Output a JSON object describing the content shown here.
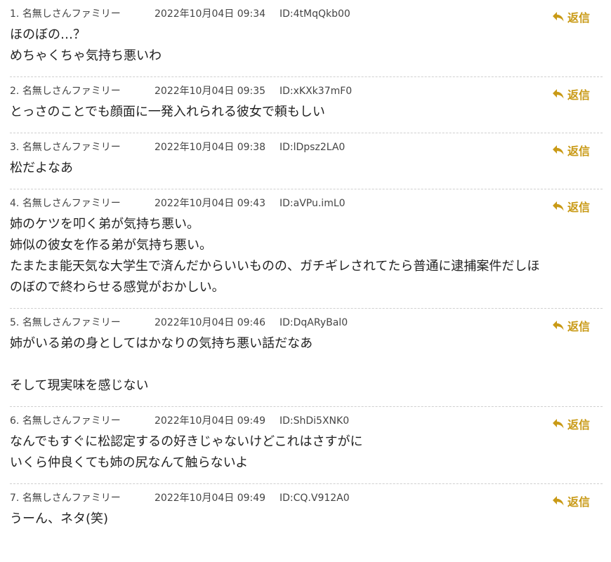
{
  "accent_color": "#c99a16",
  "reply_label": "返信",
  "comments": [
    {
      "num": "1.",
      "name": "名無しさんファミリー",
      "date": "2022年10月04日 09:34",
      "id": "ID:4tMqQkb00",
      "lines": [
        "ほのぼの…？",
        "めちゃくちゃ気持ち悪いわ"
      ]
    },
    {
      "num": "2.",
      "name": "名無しさんファミリー",
      "date": "2022年10月04日 09:35",
      "id": "ID:xKXk37mF0",
      "lines": [
        "とっさのことでも顔面に一発入れられる彼女で頼もしい"
      ]
    },
    {
      "num": "3.",
      "name": "名無しさんファミリー",
      "date": "2022年10月04日 09:38",
      "id": "ID:lDpsz2LA0",
      "lines": [
        "松だよなあ"
      ]
    },
    {
      "num": "4.",
      "name": "名無しさんファミリー",
      "date": "2022年10月04日 09:43",
      "id": "ID:aVPu.imL0",
      "lines": [
        "姉のケツを叩く弟が気持ち悪い。",
        "姉似の彼女を作る弟が気持ち悪い。",
        "たまたま能天気な大学生で済んだからいいものの、ガチギレされてたら普通に逮捕案件だしほ",
        "のぼので終わらせる感覚がおかしい。"
      ]
    },
    {
      "num": "5.",
      "name": "名無しさんファミリー",
      "date": "2022年10月04日 09:46",
      "id": "ID:DqARyBal0",
      "lines": [
        "姉がいる弟の身としてはかなりの気持ち悪い話だなあ",
        "",
        "そして現実味を感じない"
      ]
    },
    {
      "num": "6.",
      "name": "名無しさんファミリー",
      "date": "2022年10月04日 09:49",
      "id": "ID:ShDi5XNK0",
      "lines": [
        "なんでもすぐに松認定するの好きじゃないけどこれはさすがに",
        "いくら仲良くても姉の尻なんて触らないよ"
      ]
    },
    {
      "num": "7.",
      "name": "名無しさんファミリー",
      "date": "2022年10月04日 09:49",
      "id": "ID:CQ.V912A0",
      "lines": [
        "うーん、ネタ(笑)"
      ]
    }
  ]
}
